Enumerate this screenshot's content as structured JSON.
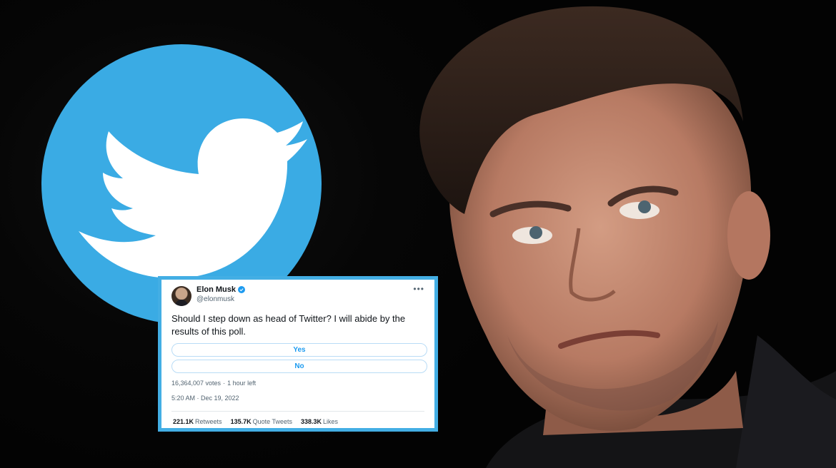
{
  "logo": {
    "icon": "twitter-bird-icon",
    "color": "#3aabe4"
  },
  "photo": {
    "subject": "man-face"
  },
  "tweet": {
    "author_name": "Elon Musk",
    "author_handle": "@elonmusk",
    "more_icon": "more-horizontal-icon",
    "verified_icon": "verified-badge-icon",
    "text": "Should I step down as head of Twitter? I will abide by the results of this poll.",
    "poll": {
      "options": [
        {
          "label": "Yes"
        },
        {
          "label": "No"
        }
      ],
      "votes_text": "16,364,007 votes",
      "separator": "·",
      "time_left": "1 hour left"
    },
    "timestamp": "5:20 AM · Dec 19, 2022",
    "stats": {
      "retweets_value": "221.1K",
      "retweets_label": "Retweets",
      "quotes_value": "135.7K",
      "quotes_label": "Quote Tweets",
      "likes_value": "338.3K",
      "likes_label": "Likes"
    },
    "accent": "#1d9bf0",
    "frame_color": "#43aee4"
  }
}
